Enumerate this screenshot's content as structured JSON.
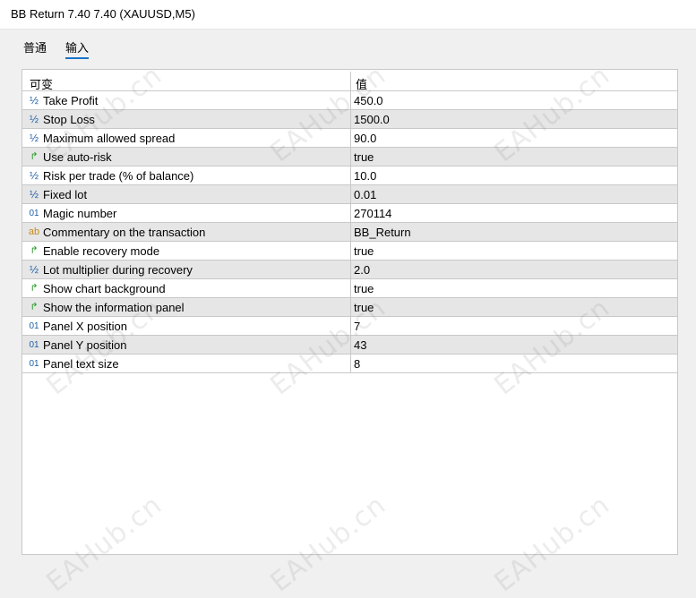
{
  "window": {
    "title": "BB Return 7.40 7.40 (XAUUSD,M5)"
  },
  "tabs": [
    {
      "label": "普通",
      "active": false
    },
    {
      "label": "输入",
      "active": true
    }
  ],
  "table": {
    "columns": [
      "可变",
      "值"
    ],
    "rows": [
      {
        "icon": "half",
        "name": "Take Profit",
        "value": "450.0"
      },
      {
        "icon": "half",
        "name": "Stop Loss",
        "value": "1500.0"
      },
      {
        "icon": "half",
        "name": "Maximum allowed spread",
        "value": "90.0"
      },
      {
        "icon": "bool",
        "name": "Use auto-risk",
        "value": "true"
      },
      {
        "icon": "half",
        "name": "Risk per trade (% of balance)",
        "value": "10.0"
      },
      {
        "icon": "half",
        "name": "Fixed lot",
        "value": "0.01"
      },
      {
        "icon": "int",
        "name": "Magic number",
        "value": "270114"
      },
      {
        "icon": "str",
        "name": "Commentary on the transaction",
        "value": "BB_Return"
      },
      {
        "icon": "bool",
        "name": "Enable recovery mode",
        "value": "true"
      },
      {
        "icon": "half",
        "name": "Lot multiplier during recovery",
        "value": "2.0"
      },
      {
        "icon": "bool",
        "name": "Show chart background",
        "value": "true"
      },
      {
        "icon": "bool",
        "name": "Show the information panel",
        "value": "true"
      },
      {
        "icon": "int",
        "name": "Panel X position",
        "value": "7"
      },
      {
        "icon": "int",
        "name": "Panel Y position",
        "value": "43"
      },
      {
        "icon": "int",
        "name": "Panel text size",
        "value": "8"
      }
    ]
  },
  "icon_glyphs": {
    "half": "½",
    "bool": "↱",
    "int": "01",
    "str": "ab"
  },
  "watermark": {
    "text": "EAHub.cn"
  },
  "colors": {
    "accent": "#1a73c9",
    "alt_row": "#e6e6e6",
    "bool_icon": "#2a9a2a",
    "number_icon": "#1f5fa8",
    "string_icon": "#c88a1b"
  }
}
